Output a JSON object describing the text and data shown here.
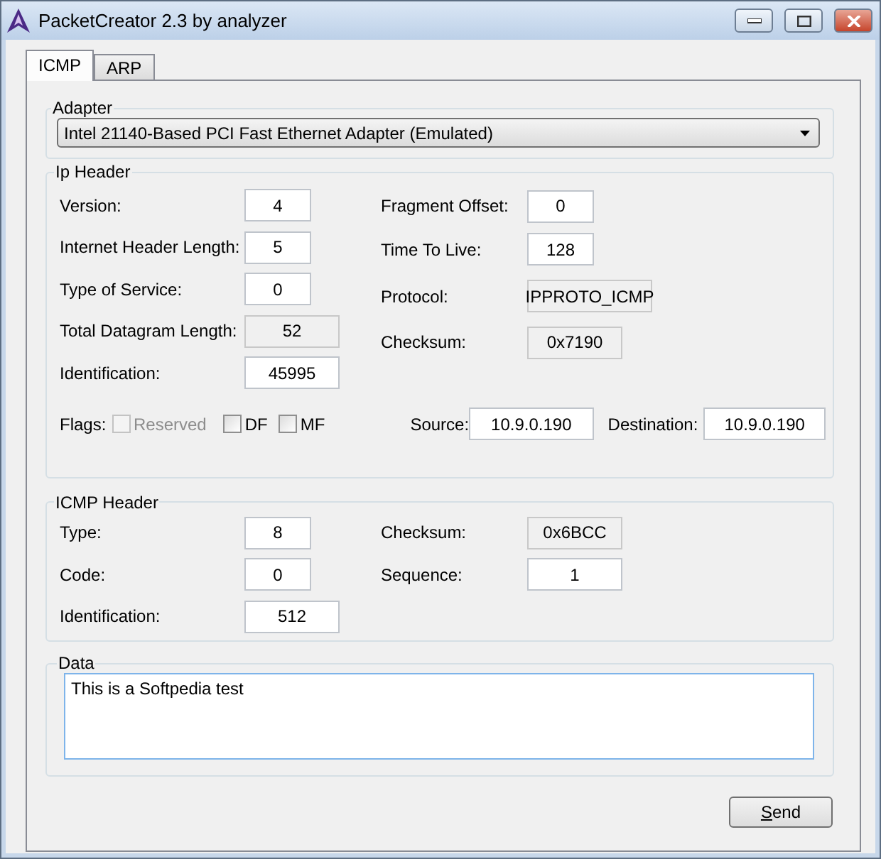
{
  "window": {
    "title": "PacketCreator 2.3 by analyzer"
  },
  "tabs": [
    {
      "label": "ICMP",
      "selected": true
    },
    {
      "label": "ARP",
      "selected": false
    }
  ],
  "adapter": {
    "title": "Adapter",
    "value": "Intel 21140-Based PCI Fast Ethernet Adapter (Emulated)"
  },
  "ip_header": {
    "title": "Ip Header",
    "left_fields": [
      {
        "label": "Version:",
        "value": "4",
        "readonly": false,
        "kind": "short"
      },
      {
        "label": "Internet Header Length:",
        "value": "5",
        "readonly": false,
        "kind": "short"
      },
      {
        "label": "Type of Service:",
        "value": "0",
        "readonly": false,
        "kind": "short"
      },
      {
        "label": "Total Datagram Length:",
        "value": "52",
        "readonly": true,
        "kind": "long"
      },
      {
        "label": "Identification:",
        "value": "45995",
        "readonly": false,
        "kind": "long"
      }
    ],
    "right_fields": [
      {
        "label": "Fragment Offset:",
        "value": "0",
        "readonly": false,
        "kind": "short"
      },
      {
        "label": "Time To Live:",
        "value": "128",
        "readonly": false,
        "kind": "short"
      },
      {
        "label": "Protocol:",
        "value": "IPPROTO_ICMP",
        "readonly": true,
        "kind": "longer"
      },
      {
        "label": "Checksum:",
        "value": "0x7190",
        "readonly": true,
        "kind": "long"
      }
    ],
    "flags": {
      "label": "Flags:",
      "items": [
        {
          "label": "Reserved",
          "checked": false,
          "disabled": true
        },
        {
          "label": "DF",
          "checked": false,
          "disabled": false
        },
        {
          "label": "MF",
          "checked": false,
          "disabled": false
        }
      ]
    },
    "source": {
      "label": "Source:",
      "value": "10.9.0.190"
    },
    "destination": {
      "label": "Destination:",
      "value": "10.9.0.190"
    }
  },
  "icmp_header": {
    "title": "ICMP Header",
    "left_fields": [
      {
        "label": "Type:",
        "value": "8",
        "readonly": false,
        "kind": "short"
      },
      {
        "label": "Code:",
        "value": "0",
        "readonly": false,
        "kind": "short"
      },
      {
        "label": "Identification:",
        "value": "512",
        "readonly": false,
        "kind": "long"
      }
    ],
    "right_fields": [
      {
        "label": "Checksum:",
        "value": "0x6BCC",
        "readonly": true,
        "kind": "long"
      },
      {
        "label": "Sequence:",
        "value": "1",
        "readonly": false,
        "kind": "long"
      }
    ]
  },
  "data": {
    "title": "Data",
    "value": "This is a Softpedia test"
  },
  "send_button": {
    "label": "Send"
  }
}
